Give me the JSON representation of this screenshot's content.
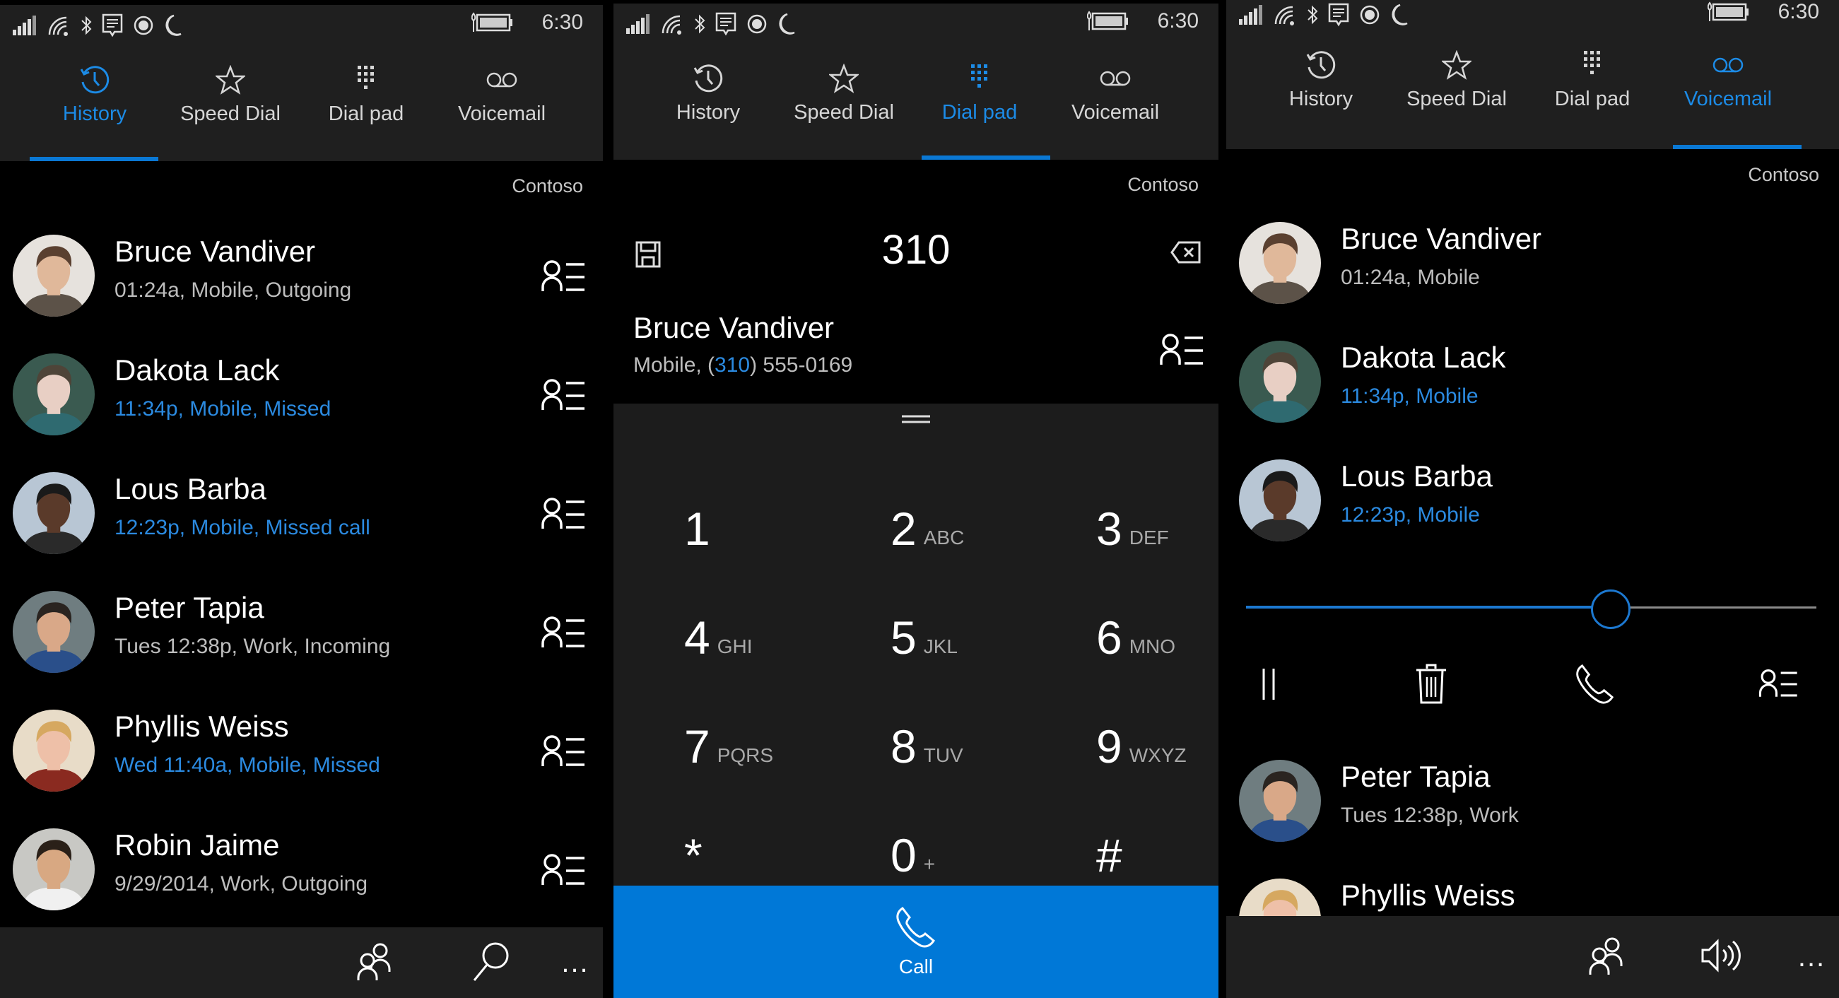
{
  "status_bar": {
    "time": "6:30",
    "icons": [
      "signal-icon",
      "wifi-icon",
      "bluetooth-icon",
      "message-icon",
      "location-icon",
      "quiet-hours-icon",
      "battery-icon"
    ]
  },
  "tabs": [
    {
      "label": "History",
      "icon": "history-icon"
    },
    {
      "label": "Speed Dial",
      "icon": "star-icon"
    },
    {
      "label": "Dial pad",
      "icon": "dialpad-icon"
    },
    {
      "label": "Voicemail",
      "icon": "voicemail-icon"
    }
  ],
  "accent_color": "#0078D7",
  "carrier": "Contoso",
  "history_screen": {
    "active_tab": "History",
    "items": [
      {
        "name": "Bruce Vandiver",
        "detail": "01:24a, Mobile, Outgoing",
        "missed": false
      },
      {
        "name": "Dakota Lack",
        "detail": "11:34p, Mobile, Missed",
        "missed": true
      },
      {
        "name": "Lous Barba",
        "detail": "12:23p, Mobile, Missed call",
        "missed": true
      },
      {
        "name": "Peter Tapia",
        "detail": "Tues 12:38p, Work, Incoming",
        "missed": false
      },
      {
        "name": "Phyllis Weiss",
        "detail": "Wed 11:40a, Mobile, Missed",
        "missed": true
      },
      {
        "name": "Robin Jaime",
        "detail": "9/29/2014, Work, Outgoing",
        "missed": false
      }
    ],
    "app_bar": [
      "contacts-icon",
      "search-icon",
      "more-icon"
    ],
    "more_label": "..."
  },
  "dialpad_screen": {
    "active_tab": "Dial pad",
    "dialed_number": "310",
    "match": {
      "name": "Bruce Vandiver",
      "prefix": "Mobile, (",
      "highlight": "310",
      "suffix": ") 555-0169"
    },
    "keys": [
      {
        "digit": "1",
        "letters": ""
      },
      {
        "digit": "2",
        "letters": "ABC"
      },
      {
        "digit": "3",
        "letters": "DEF"
      },
      {
        "digit": "4",
        "letters": "GHI"
      },
      {
        "digit": "5",
        "letters": "JKL"
      },
      {
        "digit": "6",
        "letters": "MNO"
      },
      {
        "digit": "7",
        "letters": "PQRS"
      },
      {
        "digit": "8",
        "letters": "TUV"
      },
      {
        "digit": "9",
        "letters": "WXYZ"
      },
      {
        "digit": "*",
        "letters": ""
      },
      {
        "digit": "0",
        "letters": "+"
      },
      {
        "digit": "#",
        "letters": ""
      }
    ],
    "call_label": "Call"
  },
  "voicemail_screen": {
    "active_tab": "Voicemail",
    "items": [
      {
        "name": "Bruce Vandiver",
        "detail": "01:24a, Mobile",
        "missed": false
      },
      {
        "name": "Dakota Lack",
        "detail": "11:34p, Mobile",
        "missed": true
      },
      {
        "name": "Lous Barba",
        "detail": "12:23p, Mobile",
        "missed": true
      },
      {
        "name": "Peter Tapia",
        "detail": "Tues 12:38p, Work",
        "missed": false
      },
      {
        "name": "Phyllis Weiss",
        "detail": "",
        "missed": false
      }
    ],
    "playback_progress": 0.64,
    "actions": [
      "pause-icon",
      "delete-icon",
      "call-back-icon",
      "contact-card-icon"
    ],
    "app_bar": [
      "contacts-icon",
      "speaker-icon",
      "more-icon"
    ],
    "more_label": "..."
  }
}
